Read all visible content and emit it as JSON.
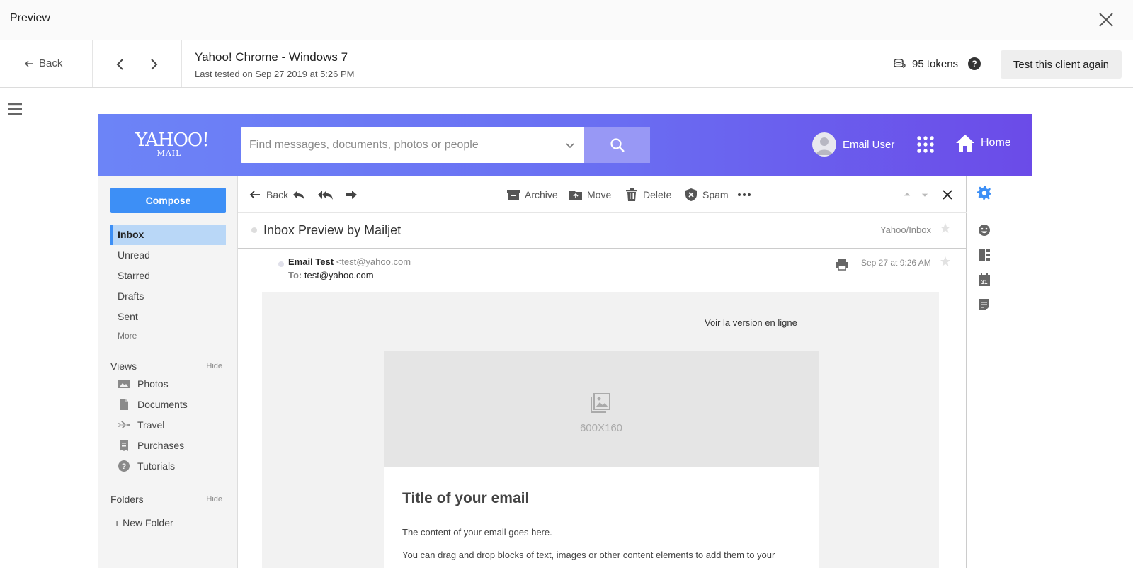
{
  "preview_bar": {
    "title": "Preview"
  },
  "subheader": {
    "back_label": "Back",
    "client_name": "Yahoo! Chrome - Windows 7",
    "last_tested": "Last tested on Sep 27 2019 at 5:26 PM",
    "tokens": "95 tokens",
    "help": "?",
    "retest_label": "Test this client again"
  },
  "yahoo": {
    "logo_line1": "YAHOO!",
    "logo_line2": "MAIL",
    "search_placeholder": "Find messages, documents, photos or people",
    "user_name": "Email User",
    "home_label": "Home",
    "colors": {
      "header_start": "#6c84f7",
      "header_end": "#6b4be8",
      "compose": "#3d8ff6",
      "active_folder": "#b9d7f7"
    }
  },
  "sidebar": {
    "compose_label": "Compose",
    "folders": [
      "Inbox",
      "Unread",
      "Starred",
      "Drafts",
      "Sent"
    ],
    "more_label": "More",
    "views_heading": "Views",
    "views_hide": "Hide",
    "views": [
      "Photos",
      "Documents",
      "Travel",
      "Purchases",
      "Tutorials"
    ],
    "folders_heading": "Folders",
    "folders_hide": "Hide",
    "new_folder": "New Folder"
  },
  "toolbar": {
    "back_label": "Back",
    "archive_label": "Archive",
    "move_label": "Move",
    "delete_label": "Delete",
    "spam_label": "Spam"
  },
  "message": {
    "subject": "Inbox Preview by Mailjet",
    "folder_path": "Yahoo/Inbox",
    "from_name": "Email Test",
    "from_email": "<test@yahoo.com",
    "to_label": "To:",
    "to_value": "test@yahoo.com",
    "date": "Sep 27 at 9:26 AM"
  },
  "email_content": {
    "online_link": "Voir la version en ligne",
    "image_placeholder": "600X160",
    "title": "Title of your email",
    "paragraph1": "The content of your email goes here.",
    "paragraph2": "You can drag and drop blocks of text, images or other content elements to add them to your"
  }
}
